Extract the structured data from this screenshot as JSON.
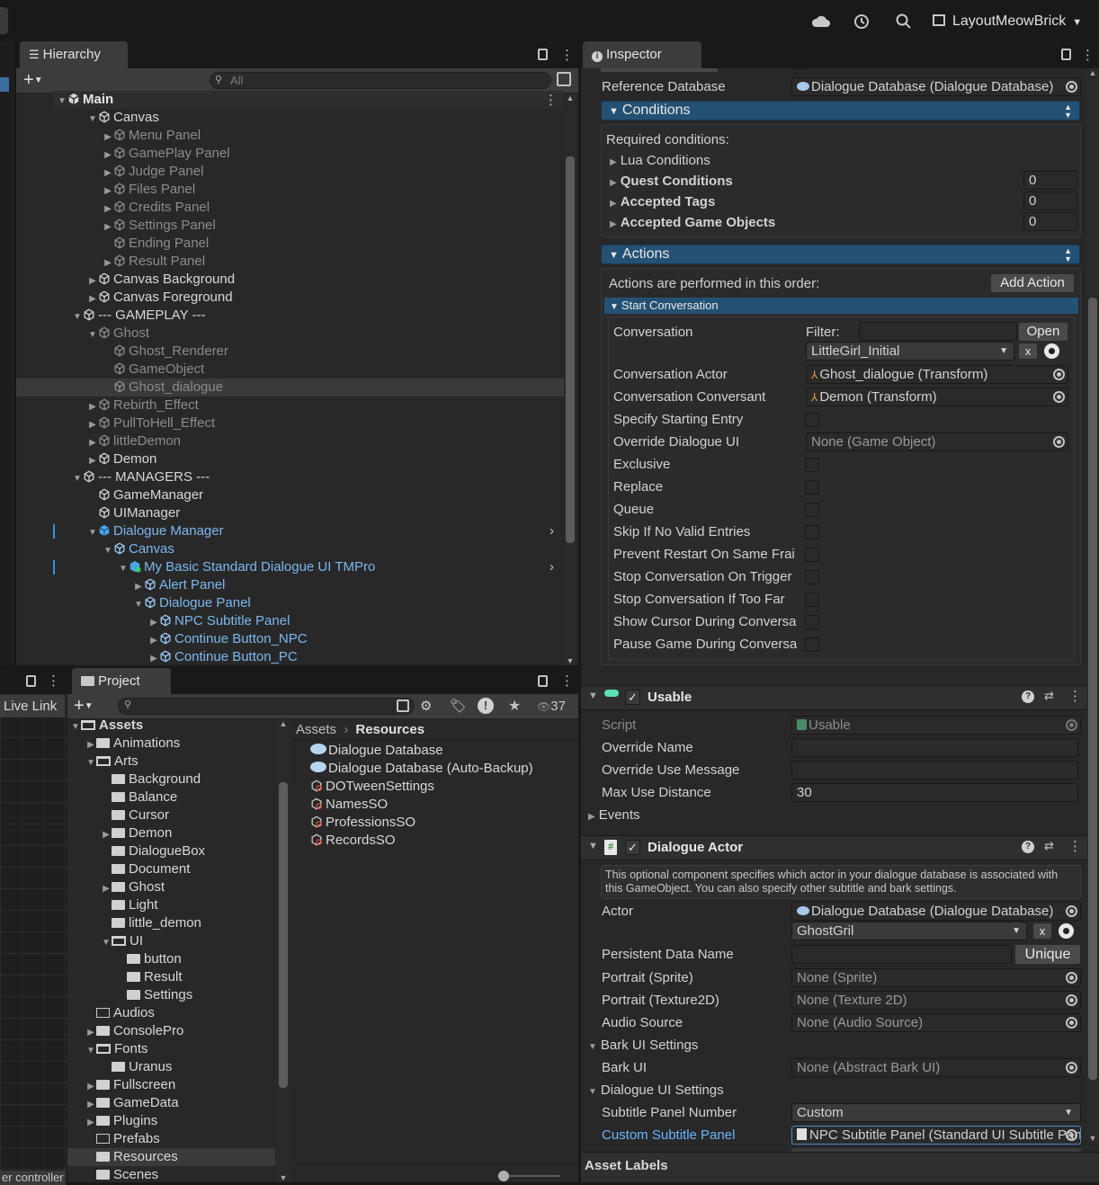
{
  "topbar": {
    "layout_label": "LayoutMeowBrick"
  },
  "hierarchy": {
    "tab": "Hierarchy",
    "search_placeholder": "All",
    "root": "Main",
    "items": [
      {
        "label": "Canvas",
        "depth": 1,
        "arrow": "open",
        "style": "normal"
      },
      {
        "label": "Menu Panel",
        "depth": 2,
        "arrow": "closed",
        "style": "dim"
      },
      {
        "label": "GamePlay Panel",
        "depth": 2,
        "arrow": "closed",
        "style": "dim"
      },
      {
        "label": "Judge Panel",
        "depth": 2,
        "arrow": "closed",
        "style": "dim"
      },
      {
        "label": "Files Panel",
        "depth": 2,
        "arrow": "closed",
        "style": "dim"
      },
      {
        "label": "Credits Panel",
        "depth": 2,
        "arrow": "closed",
        "style": "dim"
      },
      {
        "label": "Settings Panel",
        "depth": 2,
        "arrow": "closed",
        "style": "dim"
      },
      {
        "label": "Ending Panel",
        "depth": 2,
        "arrow": "none",
        "style": "dim"
      },
      {
        "label": "Result Panel",
        "depth": 2,
        "arrow": "closed",
        "style": "dim"
      },
      {
        "label": "Canvas Background",
        "depth": 1,
        "arrow": "closed",
        "style": "normal"
      },
      {
        "label": "Canvas Foreground",
        "depth": 1,
        "arrow": "closed",
        "style": "normal"
      },
      {
        "label": "--- GAMEPLAY ---",
        "depth": 0,
        "arrow": "open",
        "style": "normal"
      },
      {
        "label": "Ghost",
        "depth": 1,
        "arrow": "open",
        "style": "dim"
      },
      {
        "label": "Ghost_Renderer",
        "depth": 2,
        "arrow": "none",
        "style": "dim"
      },
      {
        "label": "GameObject",
        "depth": 2,
        "arrow": "none",
        "style": "dim"
      },
      {
        "label": "Ghost_dialogue",
        "depth": 2,
        "arrow": "none",
        "style": "dim",
        "selected": true
      },
      {
        "label": "Rebirth_Effect",
        "depth": 1,
        "arrow": "closed",
        "style": "dim"
      },
      {
        "label": "PullToHell_Effect",
        "depth": 1,
        "arrow": "closed",
        "style": "dim"
      },
      {
        "label": "littleDemon",
        "depth": 1,
        "arrow": "closed",
        "style": "dim"
      },
      {
        "label": "Demon",
        "depth": 1,
        "arrow": "closed",
        "style": "normal"
      },
      {
        "label": "--- MANAGERS ---",
        "depth": 0,
        "arrow": "open",
        "style": "normal"
      },
      {
        "label": "GameManager",
        "depth": 1,
        "arrow": "none",
        "style": "normal"
      },
      {
        "label": "UIManager",
        "depth": 1,
        "arrow": "none",
        "style": "normal"
      },
      {
        "label": "Dialogue Manager",
        "depth": 1,
        "arrow": "open",
        "style": "blue",
        "chev": true,
        "mark": true,
        "solid": true
      },
      {
        "label": "Canvas",
        "depth": 2,
        "arrow": "open",
        "style": "blue"
      },
      {
        "label": "My Basic Standard Dialogue UI TMPro",
        "depth": 3,
        "arrow": "open",
        "style": "blue",
        "chev": true,
        "mark": true,
        "solid": true
      },
      {
        "label": "Alert Panel",
        "depth": 4,
        "arrow": "closed",
        "style": "blue"
      },
      {
        "label": "Dialogue Panel",
        "depth": 4,
        "arrow": "open",
        "style": "blue"
      },
      {
        "label": "NPC Subtitle Panel",
        "depth": 5,
        "arrow": "closed",
        "style": "blue"
      },
      {
        "label": "Continue Button_NPC",
        "depth": 5,
        "arrow": "closed",
        "style": "blue"
      },
      {
        "label": "Continue Button_PC",
        "depth": 5,
        "arrow": "closed",
        "style": "blue"
      }
    ]
  },
  "project": {
    "tab": "Project",
    "live_link": "Live Link",
    "count": "37",
    "bottom_left": "er controller",
    "breadcrumb": [
      "Assets",
      "Resources"
    ],
    "tree": [
      {
        "label": "Assets",
        "depth": 0,
        "arrow": "open",
        "folder": "open",
        "bold": true
      },
      {
        "label": "Animations",
        "depth": 1,
        "arrow": "closed",
        "folder": "closed"
      },
      {
        "label": "Arts",
        "depth": 1,
        "arrow": "open",
        "folder": "open"
      },
      {
        "label": "Background",
        "depth": 2,
        "arrow": "none",
        "folder": "closed"
      },
      {
        "label": "Balance",
        "depth": 2,
        "arrow": "none",
        "folder": "closed"
      },
      {
        "label": "Cursor",
        "depth": 2,
        "arrow": "none",
        "folder": "closed"
      },
      {
        "label": "Demon",
        "depth": 2,
        "arrow": "closed",
        "folder": "closed"
      },
      {
        "label": "DialogueBox",
        "depth": 2,
        "arrow": "none",
        "folder": "closed"
      },
      {
        "label": "Document",
        "depth": 2,
        "arrow": "none",
        "folder": "closed"
      },
      {
        "label": "Ghost",
        "depth": 2,
        "arrow": "closed",
        "folder": "closed"
      },
      {
        "label": "Light",
        "depth": 2,
        "arrow": "none",
        "folder": "closed"
      },
      {
        "label": "little_demon",
        "depth": 2,
        "arrow": "none",
        "folder": "closed"
      },
      {
        "label": "UI",
        "depth": 2,
        "arrow": "open",
        "folder": "open"
      },
      {
        "label": "button",
        "depth": 3,
        "arrow": "none",
        "folder": "closed"
      },
      {
        "label": "Result",
        "depth": 3,
        "arrow": "none",
        "folder": "closed"
      },
      {
        "label": "Settings",
        "depth": 3,
        "arrow": "none",
        "folder": "closed"
      },
      {
        "label": "Audios",
        "depth": 1,
        "arrow": "none",
        "folder": "empty"
      },
      {
        "label": "ConsolePro",
        "depth": 1,
        "arrow": "closed",
        "folder": "closed"
      },
      {
        "label": "Fonts",
        "depth": 1,
        "arrow": "open",
        "folder": "open"
      },
      {
        "label": "Uranus",
        "depth": 2,
        "arrow": "none",
        "folder": "closed"
      },
      {
        "label": "Fullscreen",
        "depth": 1,
        "arrow": "closed",
        "folder": "closed"
      },
      {
        "label": "GameData",
        "depth": 1,
        "arrow": "closed",
        "folder": "closed"
      },
      {
        "label": "Plugins",
        "depth": 1,
        "arrow": "closed",
        "folder": "closed"
      },
      {
        "label": "Prefabs",
        "depth": 1,
        "arrow": "none",
        "folder": "empty"
      },
      {
        "label": "Resources",
        "depth": 1,
        "arrow": "none",
        "folder": "closed",
        "selected": true
      },
      {
        "label": "Scenes",
        "depth": 1,
        "arrow": "none",
        "folder": "closed"
      }
    ],
    "files": [
      {
        "label": "Dialogue Database",
        "icon": "db"
      },
      {
        "label": "Dialogue Database (Auto-Backup)",
        "icon": "db"
      },
      {
        "label": "DOTweenSettings",
        "icon": "so"
      },
      {
        "label": "NamesSO",
        "icon": "so"
      },
      {
        "label": "ProfessionsSO",
        "icon": "so"
      },
      {
        "label": "RecordsSO",
        "icon": "so"
      }
    ]
  },
  "inspector": {
    "tab": "Inspector",
    "reference_database_label": "Reference Database",
    "reference_database_value": "Dialogue Database (Dialogue Database)",
    "conditions_header": "Conditions",
    "required_label": "Required conditions:",
    "conditions": [
      {
        "label": "Lua Conditions",
        "value": "",
        "bold": false
      },
      {
        "label": "Quest Conditions",
        "value": "0",
        "bold": true
      },
      {
        "label": "Accepted Tags",
        "value": "0",
        "bold": true
      },
      {
        "label": "Accepted Game Objects",
        "value": "0",
        "bold": true
      }
    ],
    "actions_header": "Actions",
    "actions_order": "Actions are performed in this order:",
    "add_action": "Add Action",
    "start_conversation": "Start Conversation",
    "conversation_label": "Conversation",
    "filter_label": "Filter:",
    "open_btn": "Open",
    "conversation_value": "LittleGirl_Initial",
    "x_btn": "x",
    "sc_rows": [
      {
        "label": "Conversation Actor",
        "type": "obj",
        "value": "Ghost_dialogue (Transform)",
        "icon": "transform"
      },
      {
        "label": "Conversation Conversant",
        "type": "obj",
        "value": "Demon (Transform)",
        "icon": "transform"
      },
      {
        "label": "Specify Starting Entry",
        "type": "check"
      },
      {
        "label": "Override Dialogue UI",
        "type": "obj",
        "value": "None (Game Object)",
        "icon": "none"
      },
      {
        "label": "Exclusive",
        "type": "check"
      },
      {
        "label": "Replace",
        "type": "check"
      },
      {
        "label": "Queue",
        "type": "check"
      },
      {
        "label": "Skip If No Valid Entries",
        "type": "check"
      },
      {
        "label": "Prevent Restart On Same Frai",
        "type": "check"
      },
      {
        "label": "Stop Conversation On Trigger",
        "type": "check"
      },
      {
        "label": "Stop Conversation If Too Far",
        "type": "check"
      },
      {
        "label": "Show Cursor During Conversa",
        "type": "check"
      },
      {
        "label": "Pause Game During Conversa",
        "type": "check"
      }
    ],
    "usable": {
      "title": "Usable",
      "script_label": "Script",
      "script_value": "Usable",
      "override_name_label": "Override Name",
      "override_name_value": "",
      "override_use_label": "Override Use Message",
      "override_use_value": "",
      "max_use_label": "Max Use Distance",
      "max_use_value": "30",
      "events_label": "Events"
    },
    "actor": {
      "title": "Dialogue Actor",
      "help": "This optional component specifies which actor in your dialogue database is associated with this GameObject. You can also specify other subtitle and bark settings.",
      "actor_label": "Actor",
      "actor_db": "Dialogue Database (Dialogue Database)",
      "actor_value": "GhostGril",
      "x_btn": "x",
      "persistent_label": "Persistent Data Name",
      "persistent_value": "",
      "unique_btn": "Unique",
      "rows": [
        {
          "label": "Portrait (Sprite)",
          "value": "None (Sprite)"
        },
        {
          "label": "Portrait (Texture2D)",
          "value": "None (Texture 2D)"
        },
        {
          "label": "Audio Source",
          "value": "None (Audio Source)"
        }
      ],
      "bark_settings": "Bark UI Settings",
      "bark_ui_label": "Bark UI",
      "bark_ui_value": "None (Abstract Bark UI)",
      "dui_settings": "Dialogue UI Settings",
      "subtitle_num_label": "Subtitle Panel Number",
      "subtitle_num_value": "Custom",
      "custom_panel_label": "Custom Subtitle Panel",
      "custom_panel_value": "NPC Subtitle Panel (Standard UI Subtitle Panel)"
    },
    "asset_labels": "Asset Labels"
  },
  "colors": {
    "accent_header": "#245173",
    "selection": "#3a3a3a",
    "link": "#6ab7ff"
  }
}
